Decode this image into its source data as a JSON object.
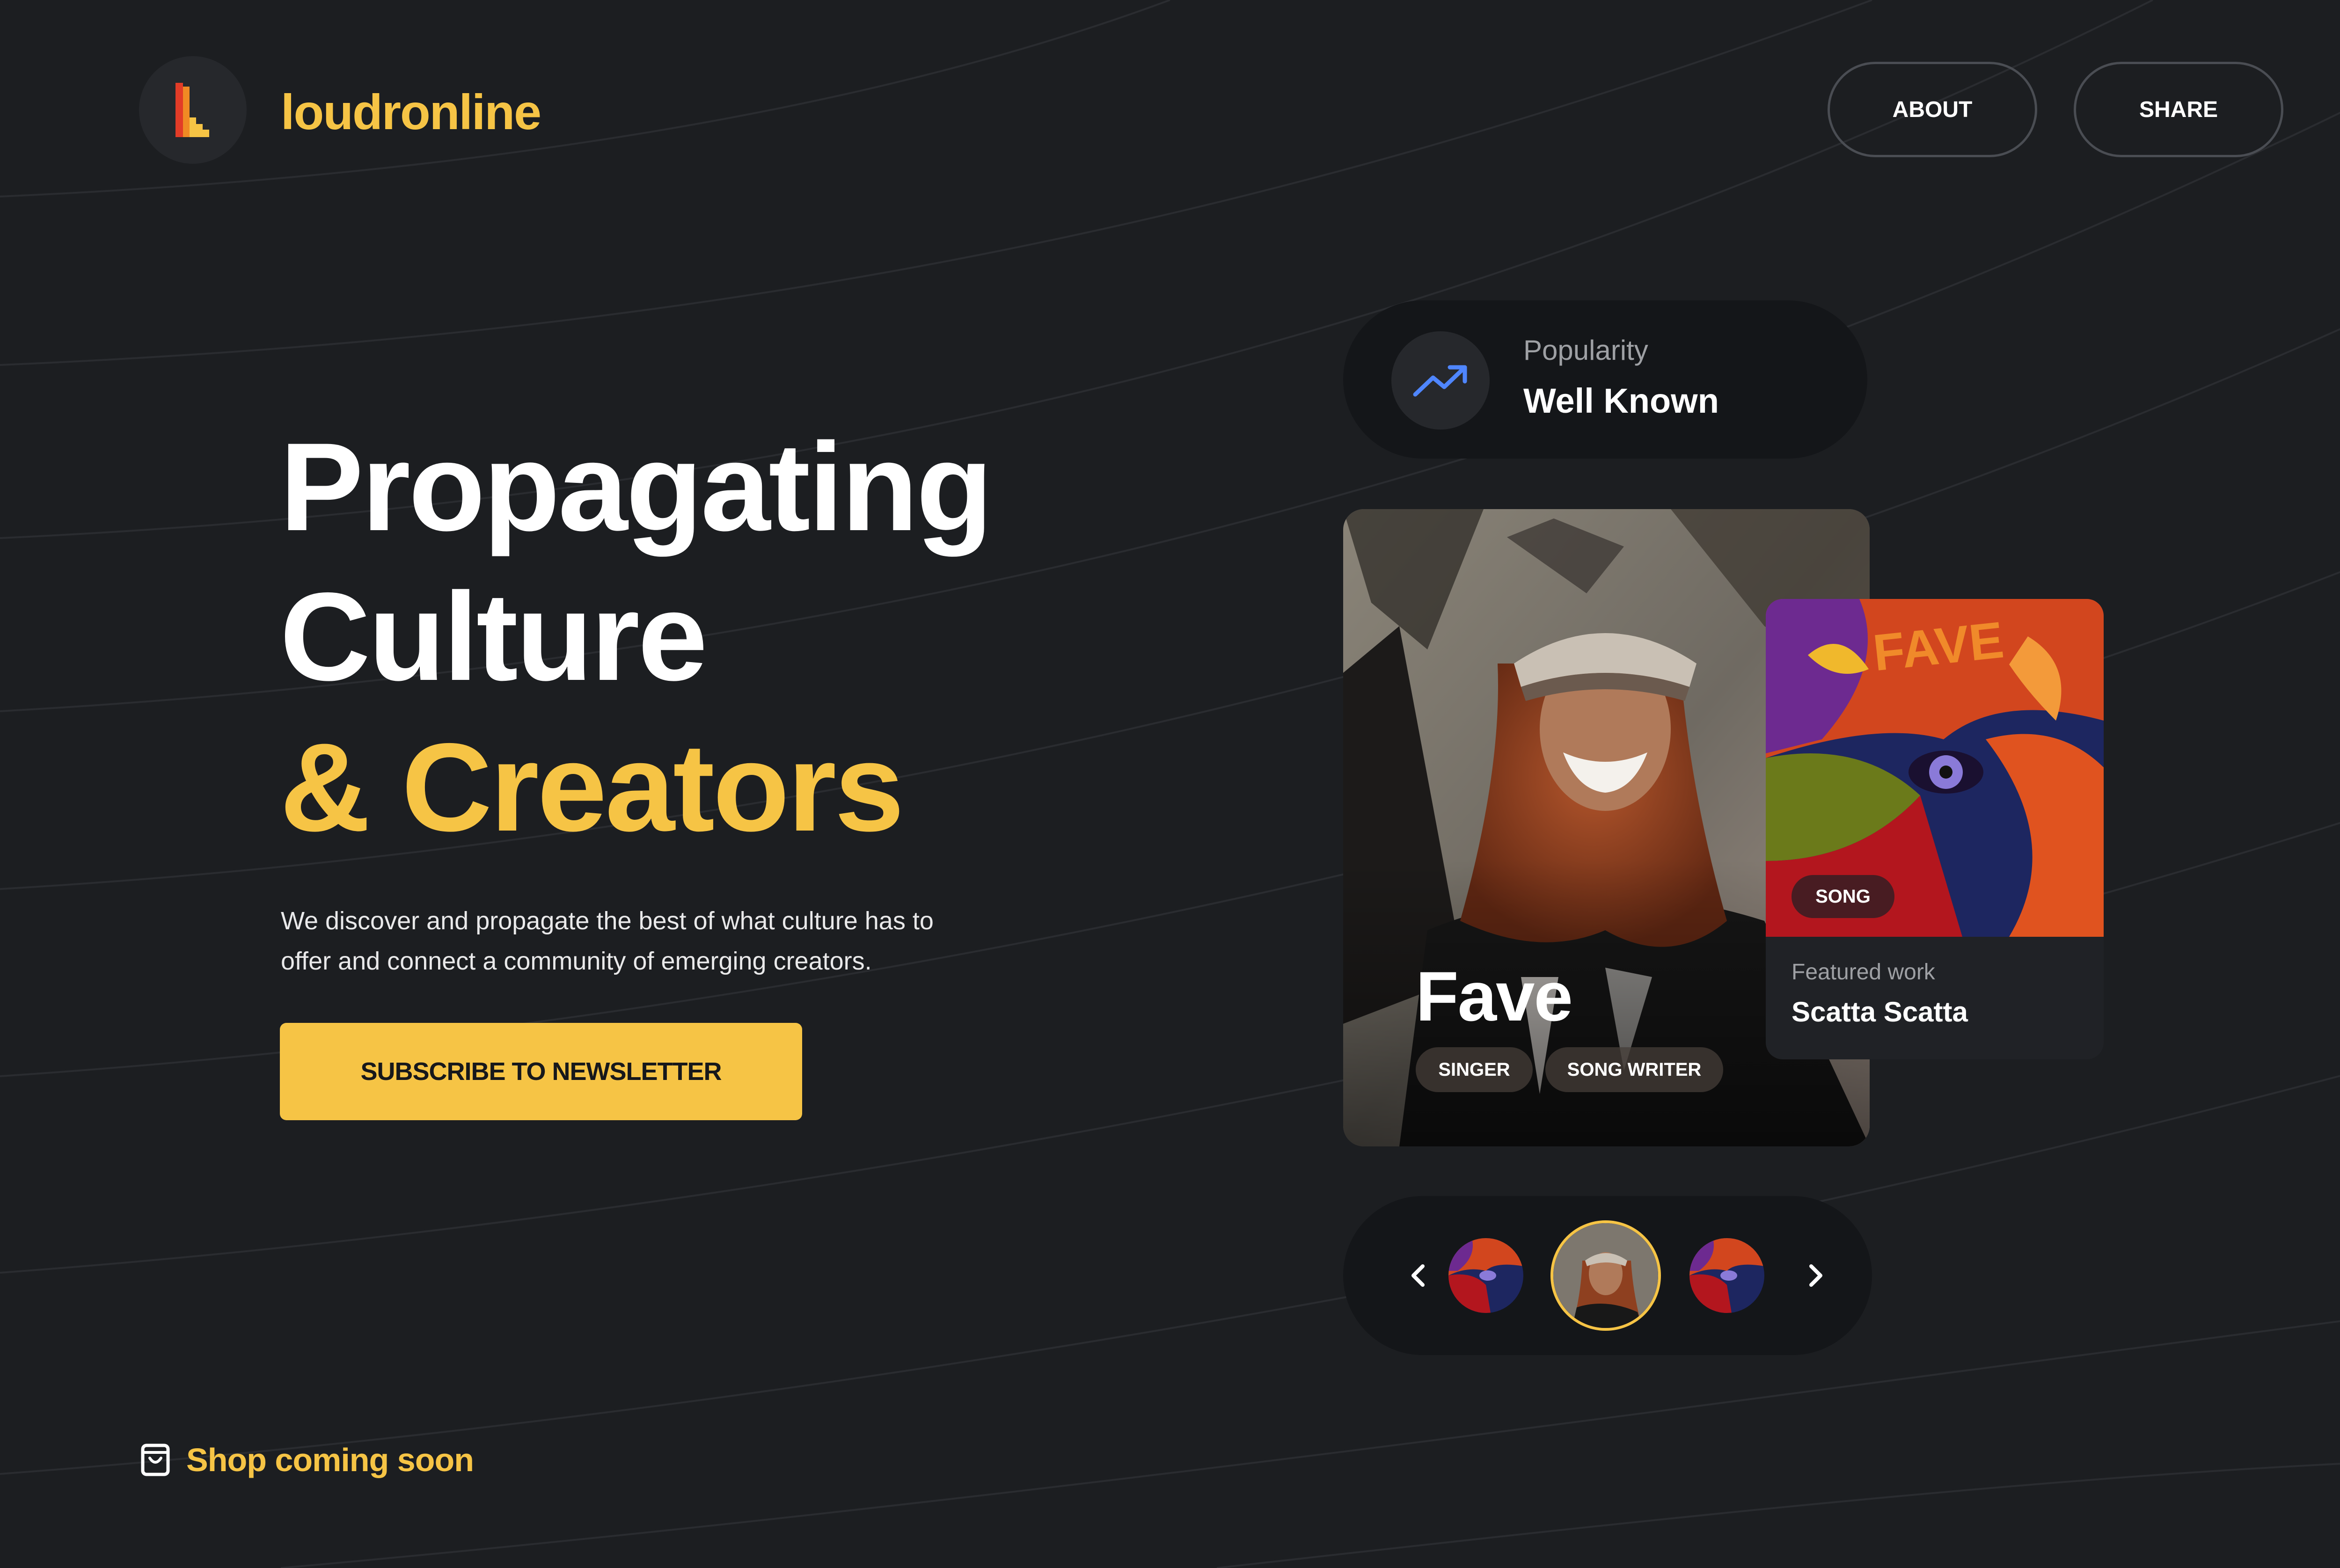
{
  "brand": {
    "name": "loudronline",
    "logo_icon": "stair-bars-logo"
  },
  "nav": {
    "about_label": "ABOUT",
    "share_label": "SHARE"
  },
  "hero": {
    "line1": "Propagating",
    "line2": "Culture",
    "line3": "& Creators",
    "description": "We discover and propagate the best of what culture has to offer and connect a community  of emerging creators.",
    "cta_label": "SUBSCRIBE TO NEWSLETTER"
  },
  "popularity": {
    "label": "Popularity",
    "value": "Well Known",
    "icon": "trending-up-icon"
  },
  "artist": {
    "name": "Fave",
    "tags": [
      "SINGER",
      "SONG WRITER"
    ]
  },
  "featured": {
    "badge": "SONG",
    "subtitle": "Featured work",
    "title": "Scatta Scatta",
    "art_text": "FAVE"
  },
  "carousel": {
    "prev_icon": "chevron-left-icon",
    "next_icon": "chevron-right-icon",
    "active_index": 1
  },
  "footer": {
    "shop_label": "Shop coming soon",
    "shop_icon": "shopping-bag-icon"
  },
  "colors": {
    "background": "#1c1e21",
    "accent": "#f6c445",
    "card": "#141619",
    "trend_icon": "#4f86ff"
  }
}
